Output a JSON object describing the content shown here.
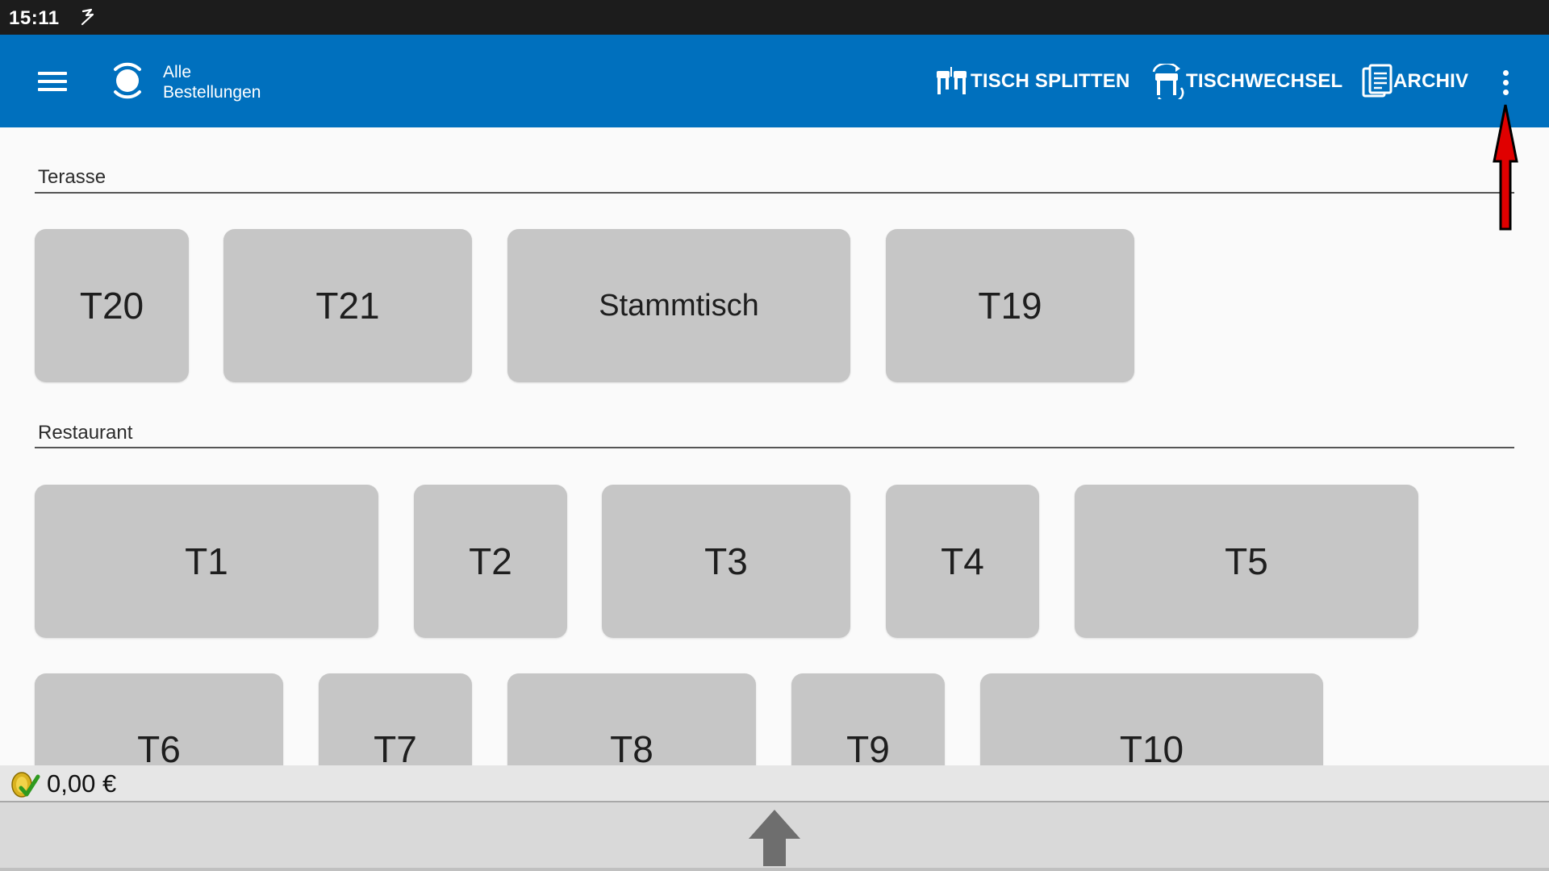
{
  "status_bar": {
    "time": "15:11",
    "icon": "sync-icon"
  },
  "app_bar": {
    "menu_icon": "hamburger-menu-icon",
    "logo_icon": "app-logo-icon",
    "title_line1": "Alle",
    "title_line2": "Bestellungen",
    "actions": [
      {
        "label": "TISCH SPLITTEN",
        "icon": "table-split-icon"
      },
      {
        "label": "TISCHWECHSEL",
        "icon": "table-change-icon"
      },
      {
        "label": "ARCHIV",
        "icon": "archive-icon"
      }
    ],
    "overflow_icon": "more-vertical-icon"
  },
  "sections": [
    {
      "label": "Terasse",
      "tables": [
        "T20",
        "T21",
        "Stammtisch",
        "T19"
      ]
    },
    {
      "label": "Restaurant",
      "tables": [
        "T1",
        "T2",
        "T3",
        "T4",
        "T5",
        "T6",
        "T7",
        "T8",
        "T9",
        "T10"
      ]
    }
  ],
  "footer": {
    "total": "0,00 €",
    "coin_icon": "coin-icon",
    "up_icon": "arrow-up-icon"
  },
  "colors": {
    "app_bar": "#0070be",
    "status_bar": "#1c1c1c",
    "table_tile": "#c6c6c6",
    "annotation_arrow": "#e00000"
  }
}
